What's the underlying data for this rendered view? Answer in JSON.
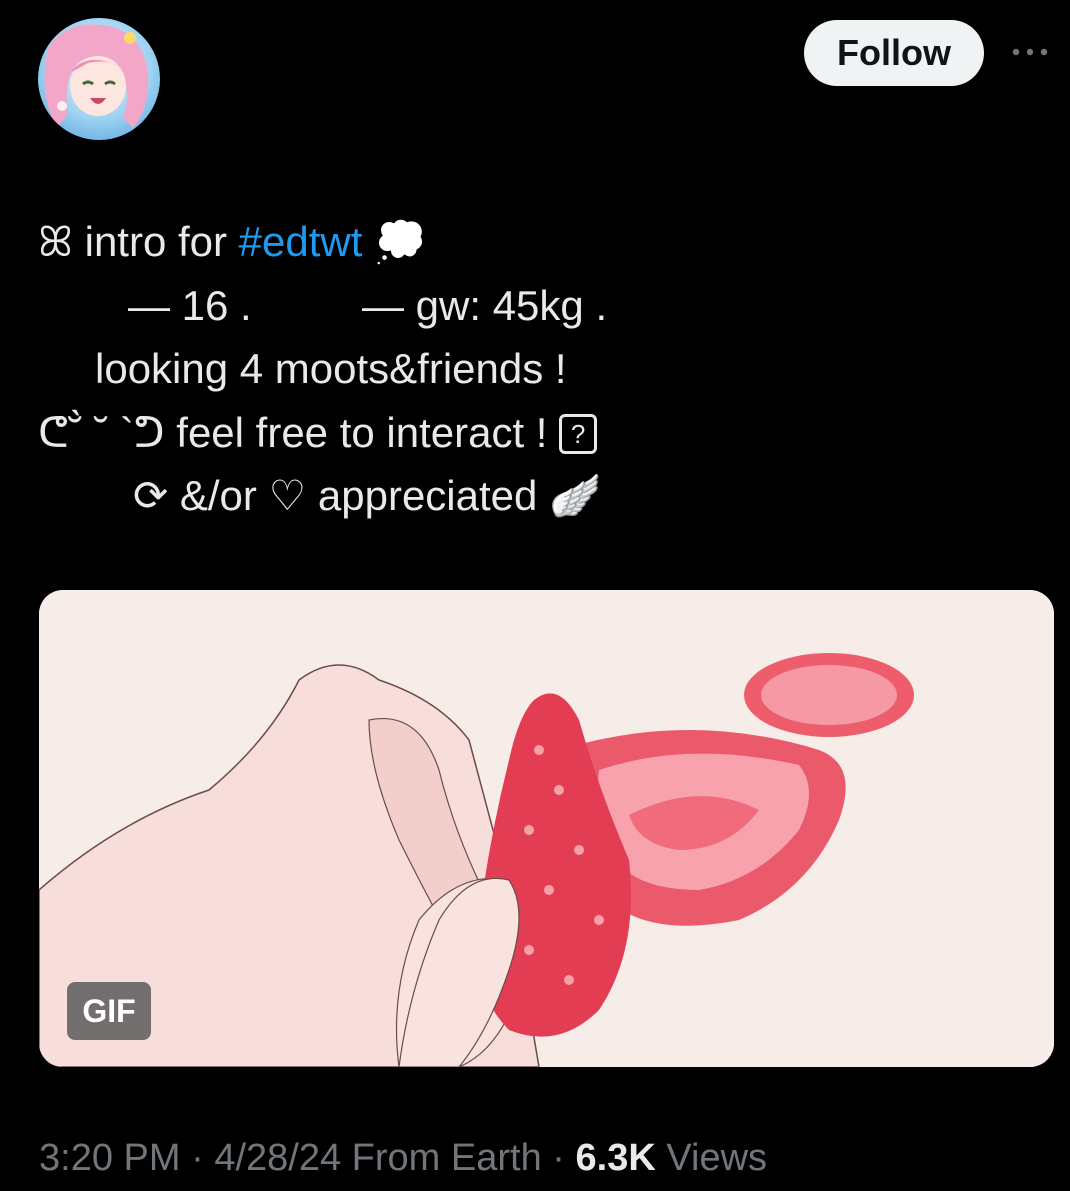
{
  "header": {
    "follow_label": "Follow",
    "more_icon": "more-horizontal-icon",
    "avatar_icon": "avatar-anime-girl-pink-hair"
  },
  "tweet": {
    "line1_prefix": "ꕤ intro for ",
    "line1_hashtag": "#edtwt",
    "line1_suffix": " 💭",
    "line2_left": "— 16 .",
    "line2_right": "— gw: 45kg .",
    "line3": "looking 4 moots&friends !",
    "line4_text": "ᕦ˘̀ ˘ `ᕤ feel free to interact ! ",
    "line4_box": "?",
    "line5": "⟳ &/or ♡ appreciated 🪽"
  },
  "media": {
    "badge": "GIF",
    "description_icon": "strawberry-gif"
  },
  "meta": {
    "time": "3:20 PM",
    "sep1": " · ",
    "date": "4/28/24",
    "location": " From Earth",
    "sep2": " · ",
    "views_count": "6.3K",
    "views_label": " Views"
  },
  "colors": {
    "background": "#000000",
    "text": "#e7e9ea",
    "secondary": "#71767b",
    "hashtag": "#1d9bf0",
    "follow_bg": "#eff3f4"
  }
}
